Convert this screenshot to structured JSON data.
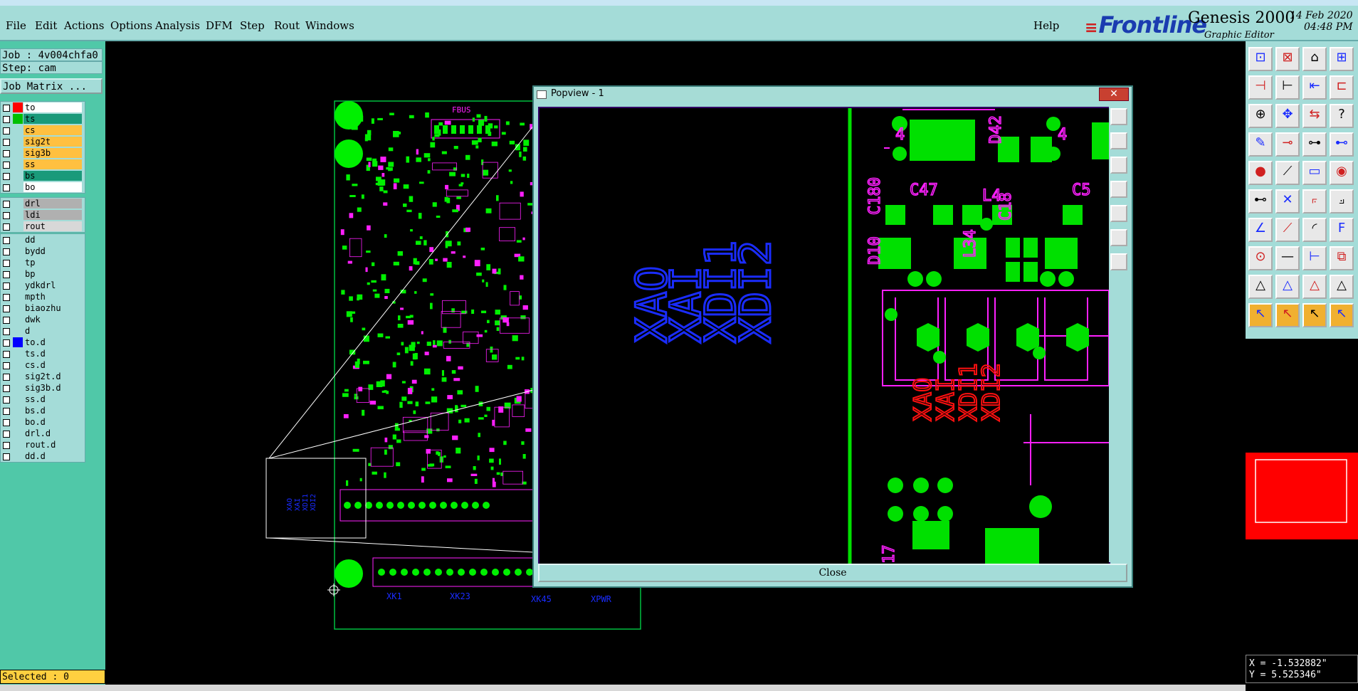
{
  "menubar": {
    "items": [
      "File",
      "Edit",
      "Actions",
      "Options",
      "Analysis",
      "DFM",
      "Step",
      "Rout",
      "Windows"
    ],
    "help": "Help"
  },
  "brand": {
    "logo": "Frontline",
    "product": "Genesis 2000",
    "subtitle": "Graphic Editor",
    "date": "14 Feb 2020",
    "time": "04:48 PM"
  },
  "job": {
    "job_line": "Job : 4v004chfa0",
    "step_line": "Step: cam",
    "matrix_button": "Job Matrix ..."
  },
  "layers": {
    "group1": [
      {
        "name": "to",
        "color": "#ff0000",
        "bg": "#ffffff"
      },
      {
        "name": "ts",
        "color": "#00c000",
        "bg": "#1a9a7a"
      },
      {
        "name": "cs",
        "color": "",
        "bg": "#ffc040"
      },
      {
        "name": "sig2t",
        "color": "",
        "bg": "#ffc040"
      },
      {
        "name": "sig3b",
        "color": "",
        "bg": "#ffc040"
      },
      {
        "name": "ss",
        "color": "",
        "bg": "#ffc040"
      },
      {
        "name": "bs",
        "color": "",
        "bg": "#1a9a7a"
      },
      {
        "name": "bo",
        "color": "",
        "bg": "#ffffff"
      }
    ],
    "group2": [
      {
        "name": "drl",
        "color": "",
        "bg": "#b0b0b0"
      },
      {
        "name": "ldi",
        "color": "",
        "bg": "#b0b0b0"
      },
      {
        "name": "rout",
        "color": "",
        "bg": "#d8d8d8"
      }
    ],
    "group3": [
      {
        "name": "dd",
        "color": "",
        "bg": "#a4dcd8"
      },
      {
        "name": "bydd",
        "color": "",
        "bg": "#a4dcd8"
      },
      {
        "name": "tp",
        "color": "",
        "bg": "#a4dcd8"
      },
      {
        "name": "bp",
        "color": "",
        "bg": "#a4dcd8"
      },
      {
        "name": "ydkdrl",
        "color": "",
        "bg": "#a4dcd8"
      },
      {
        "name": "mpth",
        "color": "",
        "bg": "#a4dcd8"
      },
      {
        "name": "biaozhu",
        "color": "",
        "bg": "#a4dcd8"
      },
      {
        "name": "dwk",
        "color": "",
        "bg": "#a4dcd8"
      },
      {
        "name": "d",
        "color": "",
        "bg": "#a4dcd8"
      },
      {
        "name": "to.d",
        "color": "#0000ff",
        "bg": "#a4dcd8"
      },
      {
        "name": "ts.d",
        "color": "",
        "bg": "#a4dcd8"
      },
      {
        "name": "cs.d",
        "color": "",
        "bg": "#a4dcd8"
      },
      {
        "name": "sig2t.d",
        "color": "",
        "bg": "#a4dcd8"
      },
      {
        "name": "sig3b.d",
        "color": "",
        "bg": "#a4dcd8"
      },
      {
        "name": "ss.d",
        "color": "",
        "bg": "#a4dcd8"
      },
      {
        "name": "bs.d",
        "color": "",
        "bg": "#a4dcd8"
      },
      {
        "name": "bo.d",
        "color": "",
        "bg": "#a4dcd8"
      },
      {
        "name": "drl.d",
        "color": "",
        "bg": "#a4dcd8"
      },
      {
        "name": "rout.d",
        "color": "",
        "bg": "#a4dcd8"
      },
      {
        "name": "dd.d",
        "color": "",
        "bg": "#a4dcd8"
      }
    ]
  },
  "status": {
    "selected": "Selected : 0"
  },
  "coords": {
    "x": "X = -1.532882\"",
    "y": "Y = 5.525346\""
  },
  "board": {
    "labels": {
      "fbus": "FBUS",
      "xk1": "XK1",
      "xk23": "XK23",
      "xk45": "XK45",
      "xpwr": "XPWR"
    }
  },
  "popview": {
    "title": "Popview - 1",
    "close_x": "✕",
    "close_button": "Close",
    "blue_labels": [
      "XAO",
      "XAI",
      "XDI1",
      "XDI2"
    ],
    "red_labels": [
      "XAO",
      "XAI",
      "XDI1",
      "XDI2"
    ],
    "pink_labels": [
      "C180",
      "C47",
      "L4",
      "C5",
      "D10",
      "L34",
      "C18",
      "D42",
      "4",
      "4",
      "17"
    ]
  },
  "colors": {
    "panel": "#a4dcd8",
    "panel_dark": "#50c8a8",
    "copper": "#00f000",
    "silkscreen": "#ff20ff",
    "text_blue": "#1a2cff",
    "text_red": "#ff1010"
  }
}
